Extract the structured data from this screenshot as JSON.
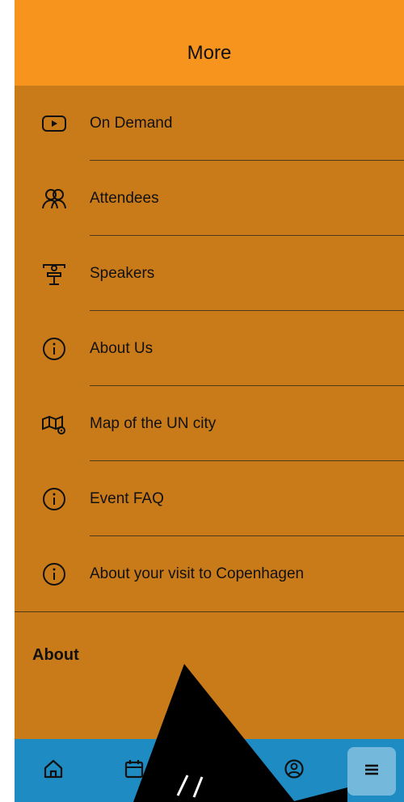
{
  "header": {
    "title": "More"
  },
  "menu": [
    {
      "label": "On Demand",
      "icon": "play-icon"
    },
    {
      "label": "Attendees",
      "icon": "attendees-icon"
    },
    {
      "label": "Speakers",
      "icon": "speaker-podium-icon"
    },
    {
      "label": "About Us",
      "icon": "info-icon"
    },
    {
      "label": "Map of the UN city",
      "icon": "map-pin-icon"
    },
    {
      "label": "Event FAQ",
      "icon": "info-icon"
    },
    {
      "label": "About your visit to Copenhagen",
      "icon": "info-icon"
    }
  ],
  "section": {
    "about_heading": "About"
  },
  "tabs": [
    {
      "name": "home",
      "icon": "home-icon",
      "active": false
    },
    {
      "name": "agenda",
      "icon": "calendar-icon",
      "active": false
    },
    {
      "name": "profile",
      "icon": "profile-icon",
      "active": false
    },
    {
      "name": "more",
      "icon": "menu-icon",
      "active": true
    }
  ],
  "colors": {
    "header_bg": "#F7941E",
    "body_bg": "#C97A19",
    "tabbar_bg": "#1E8BC3",
    "active_tab_bg": "#74b8dc"
  }
}
